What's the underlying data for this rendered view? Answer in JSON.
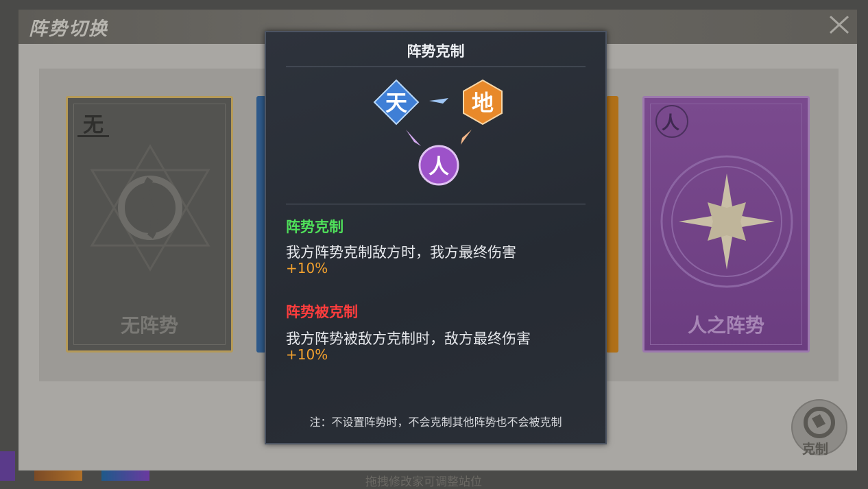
{
  "window": {
    "title": "阵势切换",
    "close_icon": "close-icon"
  },
  "cards": [
    {
      "glyph": "无",
      "name": "无阵势"
    },
    {
      "glyph": "人",
      "name": "人之阵势"
    }
  ],
  "compare_button": {
    "label": "克制",
    "icon": "compare-icon"
  },
  "bottom_hint": "拖拽修改家可调整站位",
  "popup": {
    "title": "阵势克制",
    "diagram": {
      "heaven": "天",
      "earth": "地",
      "human": "人",
      "colors": {
        "heaven": "#3f7fd6",
        "earth": "#e8892a",
        "human": "#9d52c9"
      }
    },
    "counter_heading": "阵势克制",
    "counter_desc": "我方阵势克制敌方时，我方最终伤害",
    "counter_value": "+10%",
    "countered_heading": "阵势被克制",
    "countered_desc": "我方阵势被敌方克制时，敌方最终伤害",
    "countered_value": "+10%",
    "note": "注：不设置阵势时，不会克制其他阵势也不会被克制"
  },
  "colors": {
    "positive": "#4fe05a",
    "negative": "#ff3d3d",
    "value": "#f2a12e"
  }
}
